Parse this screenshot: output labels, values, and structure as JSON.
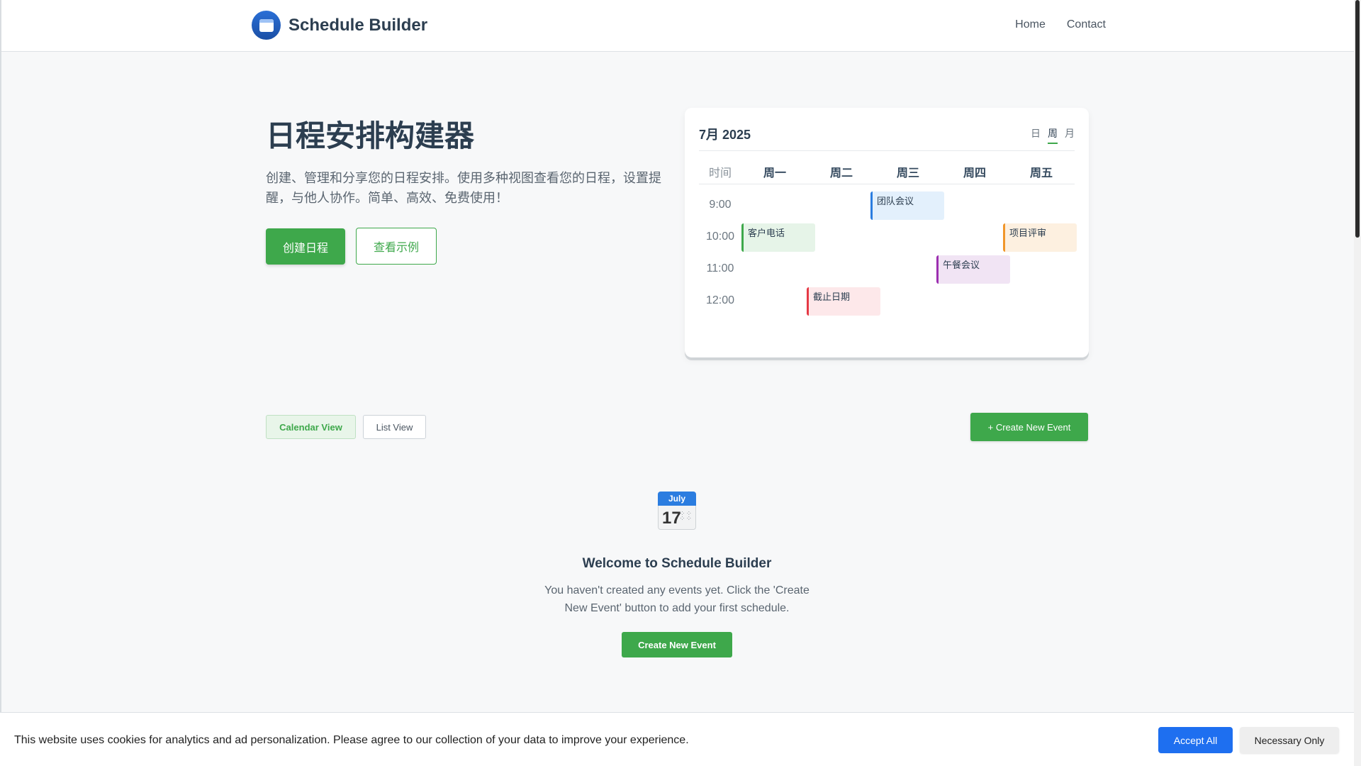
{
  "header": {
    "brand": "Schedule Builder",
    "nav": [
      "Home",
      "Contact"
    ]
  },
  "hero": {
    "title": "日程安排构建器",
    "description": "创建、管理和分享您的日程安排。使用多种视图查看您的日程，设置提醒，与他人协作。简单、高效、免费使用！",
    "primary_button": "创建日程",
    "secondary_button": "查看示例"
  },
  "calendar_preview": {
    "title": "7月 2025",
    "views": [
      "日",
      "周",
      "月"
    ],
    "active_view": "周",
    "time_header": "时间",
    "days": [
      "周一",
      "周二",
      "周三",
      "周四",
      "周五"
    ],
    "times": [
      "9:00",
      "10:00",
      "11:00",
      "12:00"
    ],
    "events": [
      {
        "label": "团队会议",
        "day": "周三",
        "time": "9:00",
        "color": "#e3f0fc",
        "accent": "#2b7de0"
      },
      {
        "label": "客户电话",
        "day": "周一",
        "time": "10:00",
        "color": "#e6f4e8",
        "accent": "#3ea84b"
      },
      {
        "label": "项目评审",
        "day": "周五",
        "time": "10:00",
        "color": "#fdf0e0",
        "accent": "#f0962a"
      },
      {
        "label": "午餐会议",
        "day": "周四",
        "time": "11:00",
        "color": "#f1e4f4",
        "accent": "#9c2fb0"
      },
      {
        "label": "截止日期",
        "day": "周二",
        "time": "12:00",
        "color": "#fde8ea",
        "accent": "#e53945"
      }
    ]
  },
  "toolbar": {
    "calendar_view": "Calendar View",
    "list_view": "List View",
    "create_button": "+ Create New Event"
  },
  "empty_state": {
    "icon_month": "July",
    "icon_day": "17",
    "title": "Welcome to Schedule Builder",
    "text": "You haven't created any events yet. Click the 'Create New Event' button to add your first schedule.",
    "button": "Create New Event"
  },
  "cookie_banner": {
    "text": "This website uses cookies for analytics and ad personalization. Please agree to our collection of your data to improve your experience.",
    "accept": "Accept All",
    "necessary": "Necessary Only"
  },
  "colors": {
    "primary_green": "#3ea84b",
    "accept_blue": "#1e6ff0"
  }
}
